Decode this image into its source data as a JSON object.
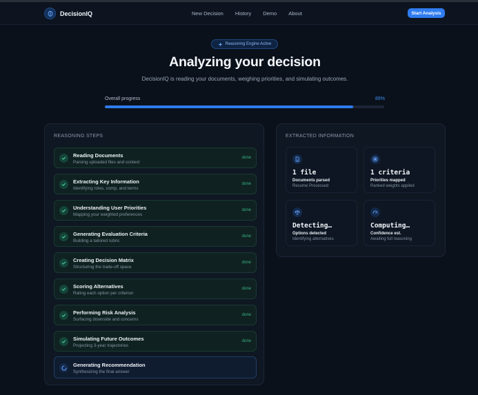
{
  "nav": {
    "brand": "DecisionIQ",
    "links": [
      "New Decision",
      "History",
      "Demo",
      "About"
    ],
    "cta": "Start Analysis"
  },
  "hero": {
    "badge": "Reasoning Engine Active",
    "title": "Analyzing your decision",
    "subtitle": "DecisionIQ is reading your documents, weighing priorities, and simulating outcomes."
  },
  "progress": {
    "label": "Overall progress",
    "percent_text": "89%",
    "percent": 89
  },
  "steps_panel": {
    "heading": "REASONING STEPS",
    "steps": [
      {
        "title": "Reading Documents",
        "desc": "Parsing uploaded files and context",
        "status": "done"
      },
      {
        "title": "Extracting Key Information",
        "desc": "Identifying roles, comp, and terms",
        "status": "done"
      },
      {
        "title": "Understanding User Priorities",
        "desc": "Mapping your weighted preferences",
        "status": "done"
      },
      {
        "title": "Generating Evaluation Criteria",
        "desc": "Building a tailored rubric",
        "status": "done"
      },
      {
        "title": "Creating Decision Matrix",
        "desc": "Structuring the trade-off space",
        "status": "done"
      },
      {
        "title": "Scoring Alternatives",
        "desc": "Rating each option per criterion",
        "status": "done"
      },
      {
        "title": "Performing Risk Analysis",
        "desc": "Surfacing downside and concerns",
        "status": "done"
      },
      {
        "title": "Simulating Future Outcomes",
        "desc": "Projecting 3-year trajectories",
        "status": "done"
      },
      {
        "title": "Generating Recommendation",
        "desc": "Synthesizing the final answer",
        "status": ""
      }
    ]
  },
  "info_panel": {
    "heading": "EXTRACTED INFORMATION",
    "cards": [
      {
        "icon": "document-icon",
        "value": "1 file",
        "label": "Documents parsed",
        "sub": "Resume Processed"
      },
      {
        "icon": "target-icon",
        "value": "1 criteria",
        "label": "Priorities mapped",
        "sub": "Ranked weights applied"
      },
      {
        "icon": "scale-icon",
        "value": "Detecting…",
        "label": "Options detected",
        "sub": "Identifying alternatives"
      },
      {
        "icon": "gauge-icon",
        "value": "Computing…",
        "label": "Confidence est.",
        "sub": "Awaiting full reasoning"
      }
    ]
  },
  "colors": {
    "accent": "#2f7cf0",
    "success": "#39b27f",
    "background": "#0b111b"
  }
}
